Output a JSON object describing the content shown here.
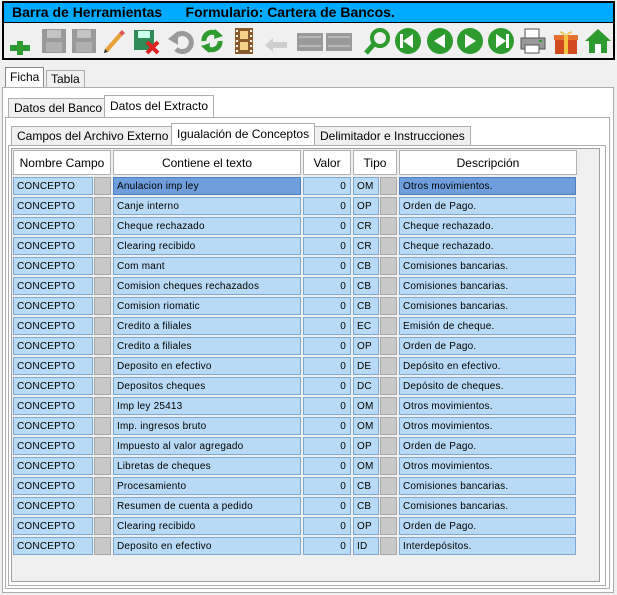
{
  "toolbar": {
    "title": "Barra de Herramientas",
    "form_title": "Formulario: Cartera de Bancos.",
    "buttons": [
      {
        "icon": "add-icon",
        "color": "#2e9b2e"
      },
      {
        "icon": "save-disabled-icon",
        "color": "#9a9a9a"
      },
      {
        "icon": "save-all-disabled-icon",
        "color": "#9a9a9a"
      },
      {
        "icon": "edit-pencil-icon",
        "color": "#e8a23a"
      },
      {
        "icon": "save-cancel-icon",
        "color": "#2e8b57"
      },
      {
        "icon": "undo-disabled-icon",
        "color": "#9a9a9a"
      },
      {
        "icon": "refresh-icon",
        "color": "#2e9b2e"
      },
      {
        "icon": "film-icon",
        "color": "#8b5a2b"
      },
      {
        "icon": "back-disabled-icon",
        "color": "#9a9a9a"
      },
      {
        "icon": "blank-disabled-icon",
        "color": "#9a9a9a"
      },
      {
        "icon": "blank2-disabled-icon",
        "color": "#9a9a9a"
      },
      {
        "icon": "search-icon",
        "color": "#2e9b2e"
      },
      {
        "icon": "first-record-icon",
        "color": "#2e9b2e"
      },
      {
        "icon": "previous-record-icon",
        "color": "#2e9b2e"
      },
      {
        "icon": "next-record-icon",
        "color": "#2e9b2e"
      },
      {
        "icon": "last-record-icon",
        "color": "#2e9b2e"
      },
      {
        "icon": "print-icon",
        "color": "#555555"
      },
      {
        "icon": "gift-icon",
        "color": "#d24a1f"
      },
      {
        "icon": "home-icon",
        "color": "#2e9b2e"
      }
    ]
  },
  "tabs_top": [
    "Ficha",
    "Tabla"
  ],
  "tabs_second": [
    "Datos del Banco",
    "Datos del Extracto"
  ],
  "tabs_third": [
    "Campos del Archivo Externo",
    "Igualación de Conceptos",
    "Delimitador e Instrucciones"
  ],
  "table": {
    "headers": [
      "Nombre Campo",
      "Contiene el texto",
      "Valor",
      "Tipo",
      "Descripción"
    ],
    "rows": [
      {
        "campo": "CONCEPTO",
        "texto": "Anulacion imp ley",
        "valor": "0",
        "tipo": "OM",
        "desc": "Otros movimientos."
      },
      {
        "campo": "CONCEPTO",
        "texto": "Canje interno",
        "valor": "0",
        "tipo": "OP",
        "desc": "Orden de Pago."
      },
      {
        "campo": "CONCEPTO",
        "texto": "Cheque rechazado",
        "valor": "0",
        "tipo": "CR",
        "desc": "Cheque rechazado."
      },
      {
        "campo": "CONCEPTO",
        "texto": "Clearing recibido",
        "valor": "0",
        "tipo": "CR",
        "desc": "Cheque rechazado."
      },
      {
        "campo": "CONCEPTO",
        "texto": "Com mant",
        "valor": "0",
        "tipo": "CB",
        "desc": "Comisiones bancarias."
      },
      {
        "campo": "CONCEPTO",
        "texto": "Comision cheques rechazados",
        "valor": "0",
        "tipo": "CB",
        "desc": "Comisiones bancarias."
      },
      {
        "campo": "CONCEPTO",
        "texto": "Comision riomatic",
        "valor": "0",
        "tipo": "CB",
        "desc": "Comisiones bancarias."
      },
      {
        "campo": "CONCEPTO",
        "texto": "Credito a filiales",
        "valor": "0",
        "tipo": "EC",
        "desc": "Emisión de cheque."
      },
      {
        "campo": "CONCEPTO",
        "texto": "Credito a filiales",
        "valor": "0",
        "tipo": "OP",
        "desc": "Orden de Pago."
      },
      {
        "campo": "CONCEPTO",
        "texto": "Deposito en efectivo",
        "valor": "0",
        "tipo": "DE",
        "desc": "Depósito en efectivo."
      },
      {
        "campo": "CONCEPTO",
        "texto": "Depositos cheques",
        "valor": "0",
        "tipo": "DC",
        "desc": "Depósito de cheques."
      },
      {
        "campo": "CONCEPTO",
        "texto": "Imp ley 25413",
        "valor": "0",
        "tipo": "OM",
        "desc": "Otros movimientos."
      },
      {
        "campo": "CONCEPTO",
        "texto": "Imp. ingresos bruto",
        "valor": "0",
        "tipo": "OM",
        "desc": "Otros movimientos."
      },
      {
        "campo": "CONCEPTO",
        "texto": "Impuesto al valor agregado",
        "valor": "0",
        "tipo": "OP",
        "desc": "Orden de Pago."
      },
      {
        "campo": "CONCEPTO",
        "texto": "Libretas de cheques",
        "valor": "0",
        "tipo": "OM",
        "desc": "Otros movimientos."
      },
      {
        "campo": "CONCEPTO",
        "texto": "Procesamiento",
        "valor": "0",
        "tipo": "CB",
        "desc": "Comisiones bancarias."
      },
      {
        "campo": "CONCEPTO",
        "texto": "Resumen de cuenta a pedido",
        "valor": "0",
        "tipo": "CB",
        "desc": "Comisiones bancarias."
      },
      {
        "campo": "CONCEPTO",
        "texto": "Clearing recibido",
        "valor": "0",
        "tipo": "OP",
        "desc": "Orden de Pago."
      },
      {
        "campo": "CONCEPTO",
        "texto": "Deposito en efectivo",
        "valor": "0",
        "tipo": "ID",
        "desc": "Interdepósitos."
      }
    ]
  }
}
